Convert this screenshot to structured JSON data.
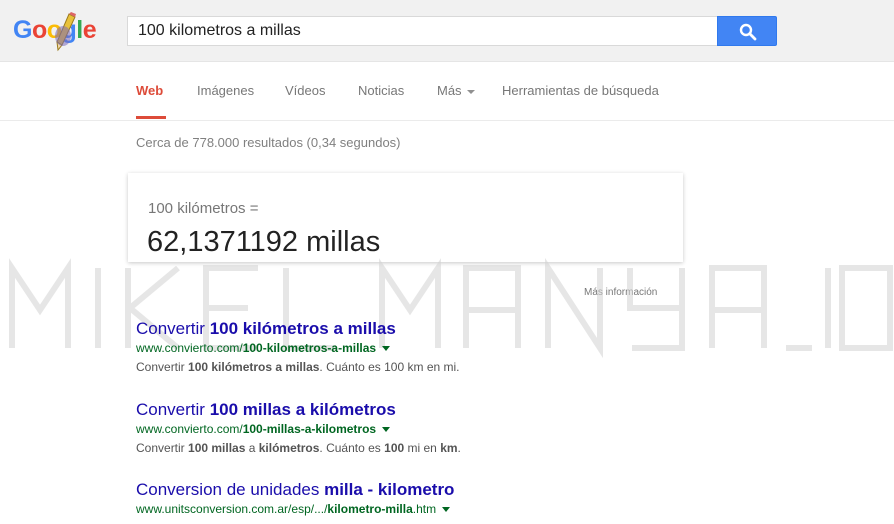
{
  "logo": {
    "text": "Google",
    "letters": [
      "G",
      "o",
      "o",
      "g",
      "l",
      "e"
    ],
    "colors": [
      "#4285f4",
      "#ea4335",
      "#fbbc05",
      "#4285f4",
      "#34a853",
      "#ea4335"
    ]
  },
  "search": {
    "query": "100 kilometros a millas",
    "button_icon": "search-icon"
  },
  "tabs": [
    {
      "label": "Web",
      "active": true
    },
    {
      "label": "Imágenes"
    },
    {
      "label": "Vídeos"
    },
    {
      "label": "Noticias"
    },
    {
      "label": "Más"
    },
    {
      "label": "Herramientas de búsqueda"
    }
  ],
  "stats": "Cerca de 778.000 resultados (0,34 segundos)",
  "converter": {
    "from": "100 kilómetros =",
    "result": "62,1371192 millas",
    "more_info": "Más información"
  },
  "watermark": "MIKEL MANYA_10",
  "results": [
    {
      "title_parts": [
        "Convertir ",
        "100 kilómetros a millas"
      ],
      "url_parts": [
        "www.convierto.com/",
        "100-kilometros-a-millas"
      ],
      "snippet_parts": [
        "Convertir ",
        "100 kilómetros a millas",
        ". Cuánto es 100 km en mi."
      ]
    },
    {
      "title_parts": [
        "Convertir ",
        "100 millas a kilómetros"
      ],
      "url_parts": [
        "www.convierto.com/",
        "100-millas-a-kilometros"
      ],
      "snippet_parts": [
        "Convertir ",
        "100 millas",
        " a ",
        "kilómetros",
        ". Cuánto es ",
        "100",
        " mi en ",
        "km",
        "."
      ]
    },
    {
      "title_parts": [
        "Conversion de unidades ",
        "milla - kilometro"
      ],
      "url_parts": [
        "www.unitsconversion.com.ar/esp/.../",
        "kilometro-milla",
        ".htm"
      ]
    }
  ],
  "colors": {
    "accent_tab": "#dd4b39",
    "link": "#1a0dab",
    "url": "#006621",
    "search_button": "#4285f4"
  }
}
